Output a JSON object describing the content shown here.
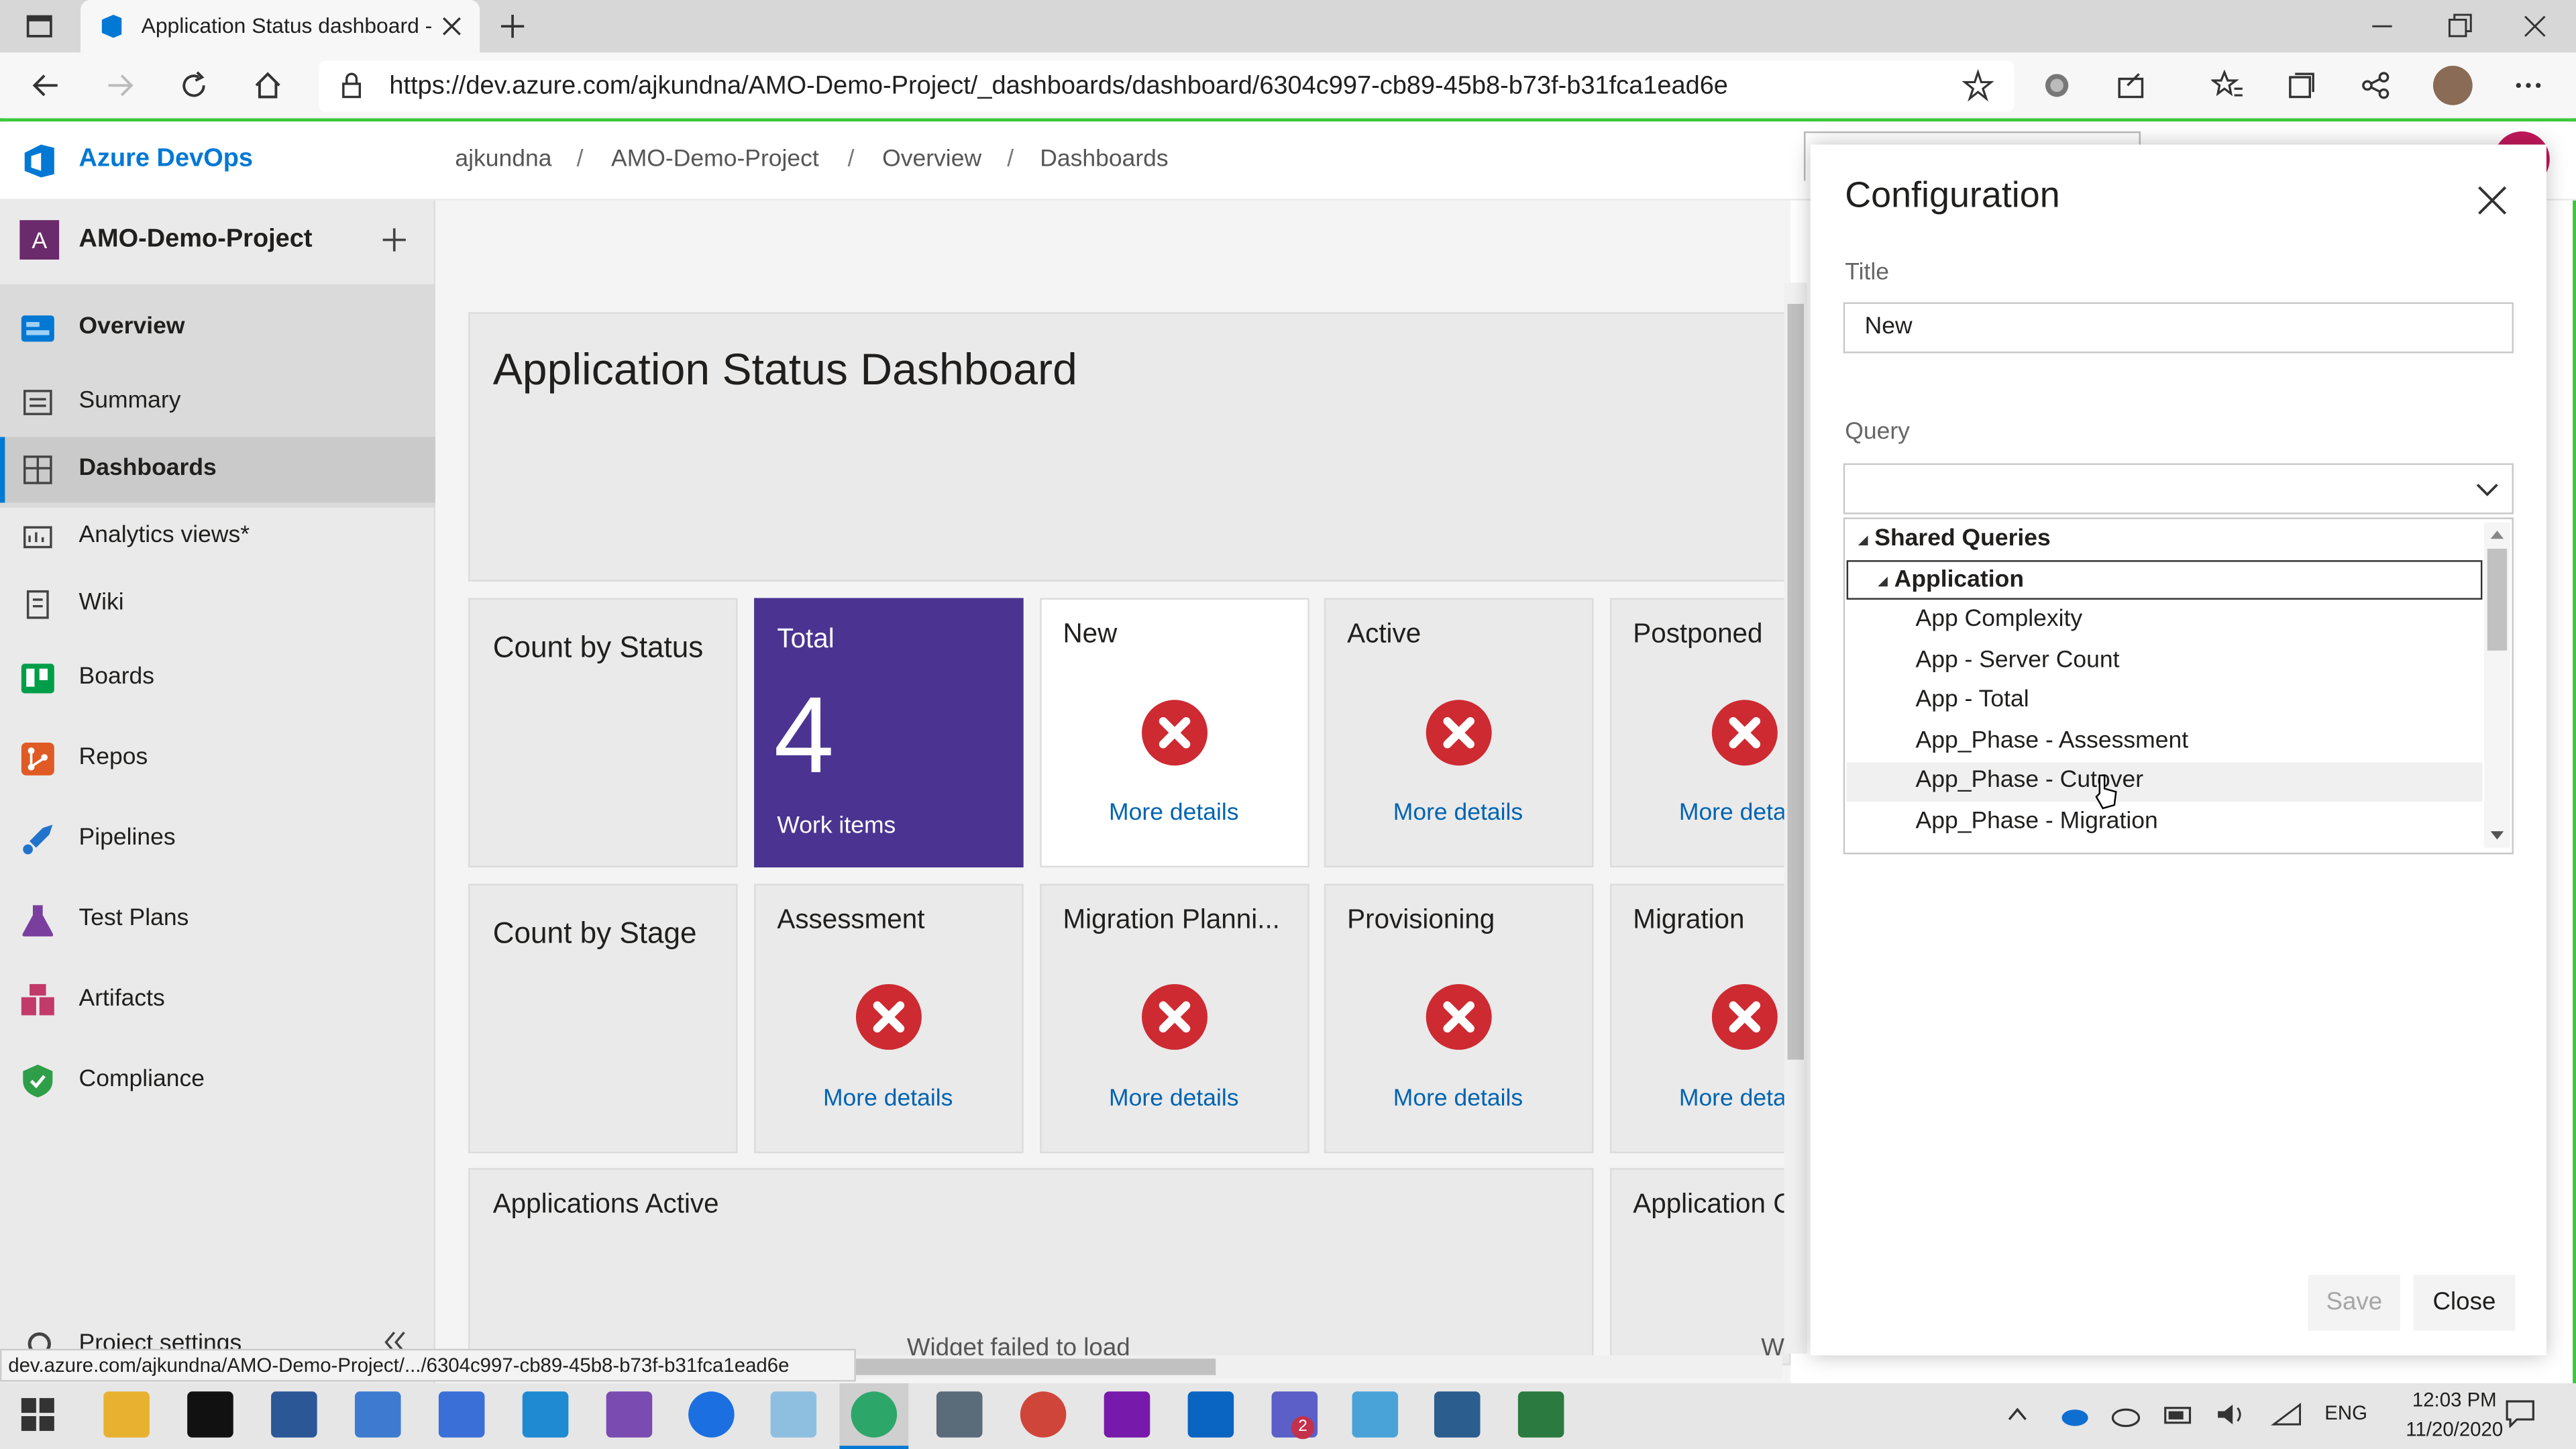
{
  "browser": {
    "tab_title": "Application Status dashboard - C",
    "url": "https://dev.azure.com/ajkundna/AMO-Demo-Project/_dashboards/dashboard/6304c997-cb89-45b8-b73f-b31fca1ead6e",
    "status_url": "dev.azure.com/ajkundna/AMO-Demo-Project/.../6304c997-cb89-45b8-b73f-b31fca1ead6e"
  },
  "header": {
    "product": "Azure DevOps",
    "breadcrumb": [
      "ajkundna",
      "AMO-Demo-Project",
      "Overview",
      "Dashboards"
    ],
    "separator": "/"
  },
  "sidebar": {
    "project_initial": "A",
    "project_name": "AMO-Demo-Project",
    "items": [
      {
        "label": "Overview",
        "icon": "overview-icon"
      },
      {
        "label": "Summary"
      },
      {
        "label": "Dashboards"
      },
      {
        "label": "Analytics views*"
      },
      {
        "label": "Wiki"
      },
      {
        "label": "Boards",
        "icon": "boards-icon"
      },
      {
        "label": "Repos",
        "icon": "repos-icon"
      },
      {
        "label": "Pipelines",
        "icon": "pipelines-icon"
      },
      {
        "label": "Test Plans",
        "icon": "test-plans-icon"
      },
      {
        "label": "Artifacts",
        "icon": "artifacts-icon"
      },
      {
        "label": "Compliance",
        "icon": "compliance-icon"
      }
    ],
    "settings_label": "Project settings"
  },
  "dashboard": {
    "title": "Application Status Dashboard",
    "count_by_status": "Count by Status",
    "total": {
      "label": "Total",
      "value": "4",
      "sub": "Work items"
    },
    "status_tiles": [
      "New",
      "Active",
      "Postponed"
    ],
    "count_by_stage": "Count by Stage",
    "stage_tiles": [
      "Assessment",
      "Migration Planni...",
      "Provisioning",
      "Migration"
    ],
    "more_details": "More details",
    "more_details_cut": "More deta",
    "apps_active": "Applications Active",
    "apps_cut": "Application C",
    "widget_failed": "Widget failed to load",
    "w_cut": "W"
  },
  "config": {
    "heading": "Configuration",
    "title_label": "Title",
    "title_value": "New",
    "query_label": "Query",
    "query_value": "",
    "tree": {
      "root": "Shared Queries",
      "folder": "Application",
      "items": [
        "App Complexity",
        "App - Server Count",
        "App - Total",
        "App_Phase - Assessment",
        "App_Phase - Cutover",
        "App_Phase - Migration"
      ]
    },
    "save": "Save",
    "close": "Close"
  },
  "taskbar": {
    "language": "ENG",
    "time": "12:03 PM",
    "date": "11/20/2020",
    "teams_badge": "2"
  },
  "colors": {
    "accent": "#0078d4",
    "total_tile": "#4b3491",
    "error": "#cd2a32",
    "frame": "#3cc83c"
  }
}
